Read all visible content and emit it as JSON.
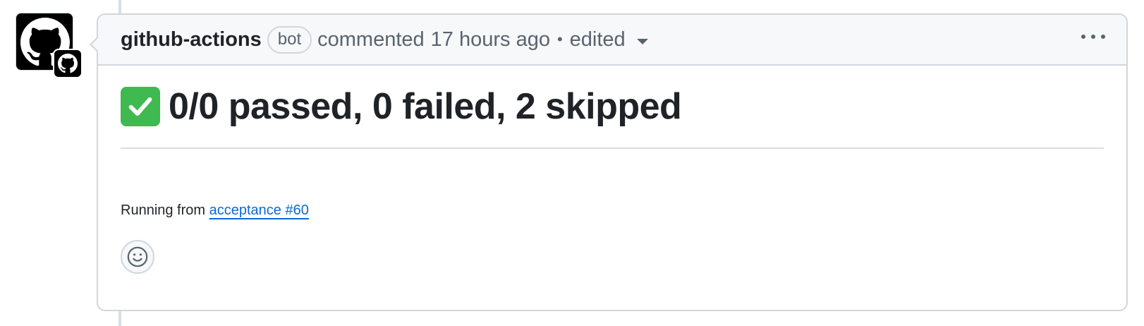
{
  "comment": {
    "author": "github-actions",
    "author_badge": "bot",
    "action": "commented",
    "timestamp": "17 hours ago",
    "separator": "•",
    "edited_label": "edited"
  },
  "body": {
    "title": "0/0 passed, 0 failed, 2 skipped",
    "running_prefix": "Running from",
    "run_link_text": "acceptance #60"
  },
  "icons": {
    "avatar": "github-octocat-icon",
    "status": "white-check-mark-icon",
    "menu": "kebab-horizontal-icon",
    "reaction": "smiley-icon"
  },
  "colors": {
    "check_green": "#3fb950",
    "link_blue": "#0969da",
    "header_bg": "#f6f8fa",
    "border": "#d0d7de"
  }
}
